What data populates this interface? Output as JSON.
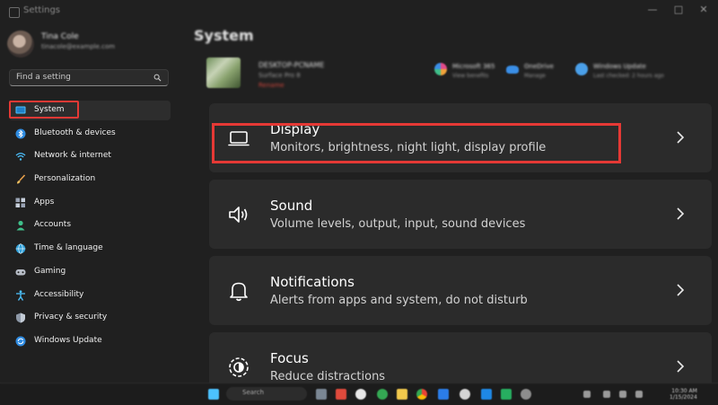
{
  "window": {
    "title": "Settings",
    "controls": [
      "—",
      "□",
      "✕"
    ]
  },
  "user": {
    "name": "Tina Cole",
    "email": "tinacole@example.com"
  },
  "search": {
    "placeholder": "Find a setting"
  },
  "nav": {
    "items": [
      {
        "label": "System",
        "icon": "monitor-icon",
        "active": true
      },
      {
        "label": "Bluetooth & devices",
        "icon": "bluetooth-icon"
      },
      {
        "label": "Network & internet",
        "icon": "wifi-icon"
      },
      {
        "label": "Personalization",
        "icon": "paintbrush-icon"
      },
      {
        "label": "Apps",
        "icon": "apps-grid-icon"
      },
      {
        "label": "Accounts",
        "icon": "person-icon"
      },
      {
        "label": "Time & language",
        "icon": "globe-clock-icon"
      },
      {
        "label": "Gaming",
        "icon": "gamepad-icon"
      },
      {
        "label": "Accessibility",
        "icon": "accessibility-icon"
      },
      {
        "label": "Privacy & security",
        "icon": "shield-icon"
      },
      {
        "label": "Windows Update",
        "icon": "update-sync-icon"
      }
    ]
  },
  "page": {
    "title": "System"
  },
  "device": {
    "name": "DESKTOP-PCNAME",
    "model": "Surface Pro 8",
    "rename_label": "Rename"
  },
  "status_items": [
    {
      "label": "Microsoft 365",
      "sub": "View benefits",
      "icon": "microsoft365-icon",
      "color": "#e24b8a"
    },
    {
      "label": "OneDrive",
      "sub": "Manage",
      "icon": "onedrive-icon",
      "color": "#3a8ee6"
    },
    {
      "label": "Windows Update",
      "sub": "Last checked: 2 hours ago",
      "icon": "windows-update-icon",
      "color": "#4a9fe8"
    }
  ],
  "cards": [
    {
      "title": "Display",
      "description": "Monitors, brightness, night light, display profile",
      "icon": "laptop-icon"
    },
    {
      "title": "Sound",
      "description": "Volume levels, output, input, sound devices",
      "icon": "speaker-icon"
    },
    {
      "title": "Notifications",
      "description": "Alerts from apps and system, do not disturb",
      "icon": "bell-icon"
    },
    {
      "title": "Focus",
      "description": "Reduce distractions",
      "icon": "focus-icon"
    }
  ],
  "taskbar": {
    "search_label": "Search",
    "time": "10:30 AM",
    "date": "1/15/2024"
  },
  "colors": {
    "accent": "#4cc2ff",
    "highlight": "#e53935",
    "background": "#202020",
    "card": "#2b2b2b"
  }
}
